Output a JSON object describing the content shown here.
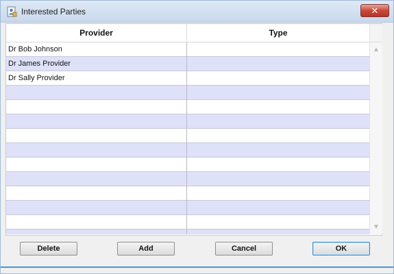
{
  "window": {
    "title": "Interested Parties",
    "icon": "document-user-icon",
    "close_glyph": "✕"
  },
  "grid": {
    "columns": [
      "Provider",
      "Type"
    ],
    "rows": [
      {
        "provider": "Dr Bob Johnson",
        "type": ""
      },
      {
        "provider": "Dr James Provider",
        "type": ""
      },
      {
        "provider": "Dr Sally Provider",
        "type": ""
      },
      {
        "provider": "",
        "type": ""
      },
      {
        "provider": "",
        "type": ""
      },
      {
        "provider": "",
        "type": ""
      },
      {
        "provider": "",
        "type": ""
      },
      {
        "provider": "",
        "type": ""
      },
      {
        "provider": "",
        "type": ""
      },
      {
        "provider": "",
        "type": ""
      },
      {
        "provider": "",
        "type": ""
      },
      {
        "provider": "",
        "type": ""
      },
      {
        "provider": "",
        "type": ""
      },
      {
        "provider": "",
        "type": ""
      }
    ]
  },
  "buttons": {
    "delete": "Delete",
    "add": "Add",
    "cancel": "Cancel",
    "ok": "OK"
  },
  "colors": {
    "row_alt": "#dfe1f8",
    "close": "#c8493a",
    "focus": "#3a8ccf"
  }
}
